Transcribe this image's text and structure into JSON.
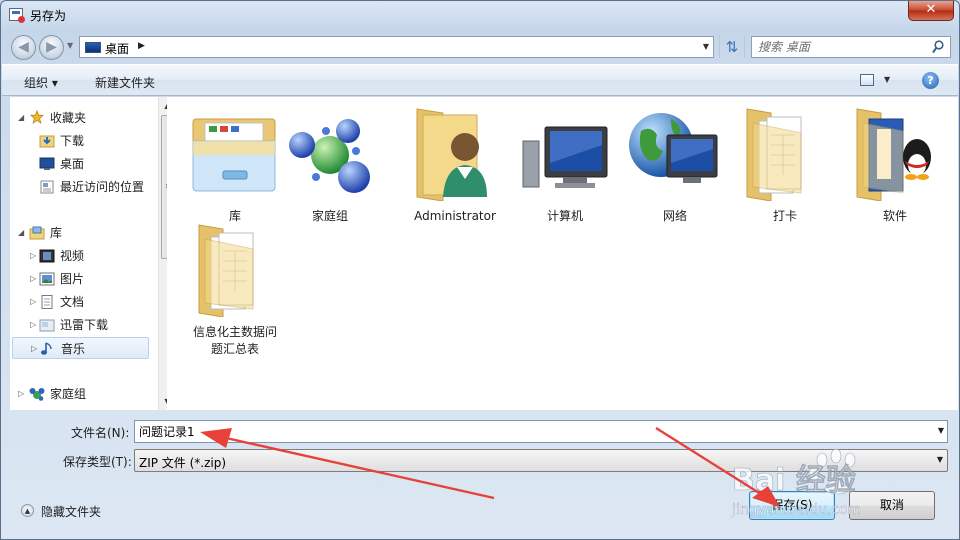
{
  "window": {
    "title": "另存为",
    "close_label": "✕"
  },
  "nav": {
    "back_glyph": "◀",
    "forward_glyph": "▶",
    "address": {
      "location": "桌面",
      "arrow": "▶"
    },
    "search": {
      "placeholder": "搜索 桌面"
    }
  },
  "toolbar": {
    "organize_label": "组织 ▾",
    "new_folder_label": "新建文件夹",
    "help_label": "?"
  },
  "sidebar": {
    "favorites": {
      "label": "收藏夹",
      "items": [
        {
          "label": "下载",
          "icon": "download-folder-icon"
        },
        {
          "label": "桌面",
          "icon": "desktop-icon"
        },
        {
          "label": "最近访问的位置",
          "icon": "recent-places-icon"
        }
      ]
    },
    "libraries": {
      "label": "库",
      "items": [
        {
          "label": "视频",
          "icon": "video-library-icon"
        },
        {
          "label": "图片",
          "icon": "pictures-library-icon"
        },
        {
          "label": "文档",
          "icon": "documents-library-icon"
        },
        {
          "label": "迅雷下载",
          "icon": "thunder-download-icon"
        },
        {
          "label": "音乐",
          "icon": "music-library-icon",
          "selected": true
        }
      ]
    },
    "homegroup": {
      "label": "家庭组"
    }
  },
  "files": [
    {
      "label": "库",
      "icon": "libraries-folder-icon"
    },
    {
      "label": "家庭组",
      "icon": "homegroup-icon"
    },
    {
      "label": "Administrator",
      "icon": "user-folder-icon"
    },
    {
      "label": "计算机",
      "icon": "computer-icon"
    },
    {
      "label": "网络",
      "icon": "network-icon"
    },
    {
      "label": "打卡",
      "icon": "folder-icon"
    },
    {
      "label": "软件",
      "icon": "qq-folder-icon"
    },
    {
      "label": "信息化主数据问题汇总表",
      "icon": "folder-icon"
    }
  ],
  "form": {
    "filename_label": "文件名(N):",
    "filename_value": "问题记录1",
    "filetype_label": "保存类型(T):",
    "filetype_value": "ZIP 文件 (*.zip)"
  },
  "footer": {
    "hide_folders_label": "隐藏文件夹",
    "save_label": "保存(S)",
    "cancel_label": "取消"
  },
  "watermark": {
    "brand": "Bai  经验",
    "site": "jingyan.baidu.com"
  },
  "colors": {
    "accent": "#3c7fb1",
    "arrow": "#e8413a"
  }
}
